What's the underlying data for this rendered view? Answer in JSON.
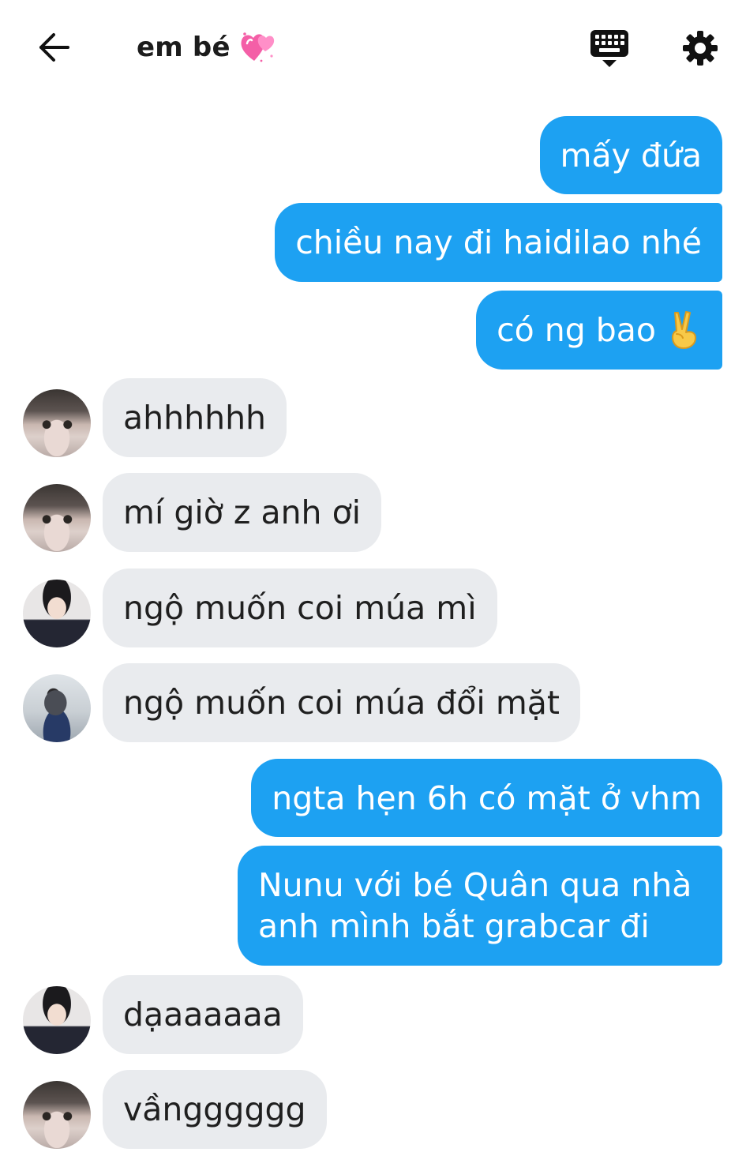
{
  "header": {
    "title": "em bé",
    "back_icon": "arrow-left-icon",
    "title_icon": "two-hearts-icon",
    "keyboard_icon": "keyboard-icon",
    "settings_icon": "gear-icon"
  },
  "colors": {
    "outgoing_bubble": "#1da1f2",
    "incoming_bubble": "#e9ebee",
    "background": "#ffffff"
  },
  "messages": [
    {
      "direction": "outgoing",
      "text": "mấy đứa"
    },
    {
      "direction": "outgoing",
      "text": "chiều nay đi haidilao nhé"
    },
    {
      "direction": "outgoing",
      "text": "có ng bao",
      "emoji": "victory-hand-icon"
    },
    {
      "direction": "incoming",
      "sender_avatar": "avatar-a",
      "text": "ahhhhhh"
    },
    {
      "direction": "incoming",
      "sender_avatar": "avatar-a",
      "text": "mí giờ z anh ơi"
    },
    {
      "direction": "incoming",
      "sender_avatar": "avatar-b",
      "text": "ngộ muốn coi múa mì"
    },
    {
      "direction": "incoming",
      "sender_avatar": "avatar-c",
      "text": "ngộ muốn coi múa đổi mặt"
    },
    {
      "direction": "outgoing",
      "text": "ngta hẹn 6h có mặt ở vhm"
    },
    {
      "direction": "outgoing",
      "text_lines": [
        "Nunu với bé Quân qua nhà",
        "anh mình bắt grabcar đi"
      ]
    },
    {
      "direction": "incoming",
      "sender_avatar": "avatar-b",
      "text": "dạaaaaaa"
    },
    {
      "direction": "incoming",
      "sender_avatar": "avatar-a",
      "text": "vầngggggg"
    }
  ]
}
